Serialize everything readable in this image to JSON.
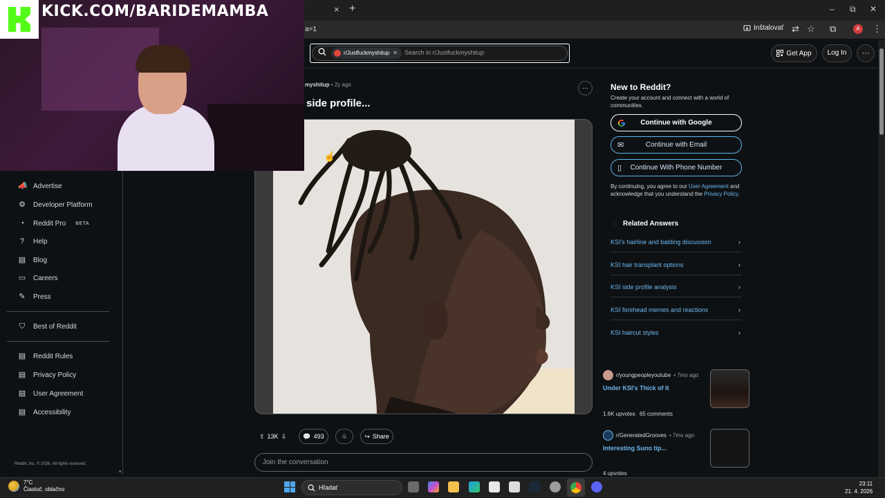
{
  "browser": {
    "url_fragment": "a=1",
    "install_label": "Inštalovať",
    "tab_close": "×",
    "tab_new": "+",
    "minimize": "–",
    "maximize": "⧉",
    "close": "✕",
    "profile_initial": "A"
  },
  "stream_overlay": {
    "kick_text": "KICK.COM/BARIDEMAMBA"
  },
  "header": {
    "subreddit_chip": "r/Justfuckmyshitup",
    "search_placeholder": "Search in r/Justfuckmyshitup",
    "get_app": "Get App",
    "log_in": "Log In",
    "more": "···"
  },
  "sidebar": {
    "items": [
      {
        "label": "Advertise",
        "icon": "megaphone-icon"
      },
      {
        "label": "Developer Platform",
        "icon": "gear-icon"
      },
      {
        "label": "Reddit Pro",
        "badge": "BETA",
        "icon": "pro-icon"
      },
      {
        "label": "Help",
        "icon": "help-icon"
      },
      {
        "label": "Blog",
        "icon": "book-icon"
      },
      {
        "label": "Careers",
        "icon": "briefcase-icon"
      },
      {
        "label": "Press",
        "icon": "pen-icon"
      }
    ],
    "best": {
      "label": "Best of Reddit",
      "icon": "bookmark-icon"
    },
    "legal": [
      {
        "label": "Reddit Rules",
        "icon": "book-icon"
      },
      {
        "label": "Privacy Policy",
        "icon": "book-icon"
      },
      {
        "label": "User Agreement",
        "icon": "book-icon"
      },
      {
        "label": "Accessibility",
        "icon": "book-icon"
      }
    ],
    "copyright": "Reddit, Inc. © 2026. All rights reserved."
  },
  "post": {
    "subreddit_partial": "myshitup",
    "age": "• 2y ago",
    "title": "side profile...",
    "more": "···",
    "upvotes": "13K",
    "comments": "493",
    "share": "Share",
    "join_placeholder": "Join the conversation"
  },
  "right": {
    "new_title": "New to Reddit?",
    "new_sub": "Create your account and connect with a world of communities.",
    "google": "Continue with Google",
    "email": "Continue with Email",
    "phone": "Continue With Phone Number",
    "terms_pre": "By continuing, you agree to our",
    "terms_ua": "User Agreement",
    "terms_mid": "and acknowledge that you understand the",
    "terms_pp": "Privacy Policy",
    "terms_end": ".",
    "related_title": "Related Answers",
    "related": [
      "KSI's hairline and balding discussion",
      "KSI hair transplant options",
      "KSI side profile analysis",
      "KSI forehead memes and reactions",
      "KSI haircut styles"
    ],
    "posts": [
      {
        "sub": "r/youngpeopleyoutube",
        "time": "• 7mo ago",
        "title": "Under KSI's Thick of It",
        "upvotes": "1.6K upvotes",
        "comments": "65 comments"
      },
      {
        "sub": "r/GeneratedGrooves",
        "time": "• 7mo ago",
        "title": "Interesting Suno tip...",
        "upvotes": "4 upvotes",
        "comments": ""
      }
    ]
  },
  "taskbar": {
    "temp": "7°C",
    "weather": "Čiastoč. oblačno",
    "search": "Hľadať",
    "time": "23:11",
    "date": "21. 4. 2026"
  },
  "colors": {
    "accent_link": "#6db7f0",
    "kick_green": "#53fc18",
    "bg": "#0e1113"
  }
}
